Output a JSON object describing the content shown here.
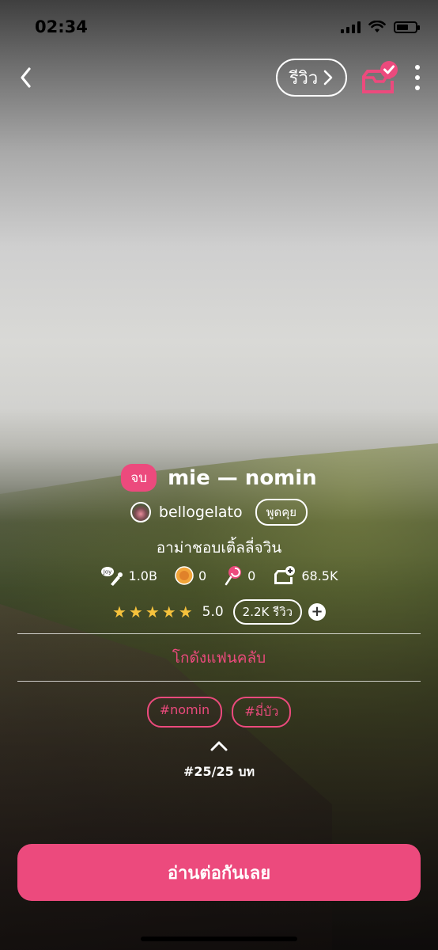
{
  "status_bar": {
    "time": "02:34"
  },
  "header": {
    "review_label": "รีวิว"
  },
  "story": {
    "end_badge": "จบ",
    "title": "mie — nomin",
    "author": "bellogelato",
    "chat_label": "พูดคุย",
    "description": "อาม่าชอบเติ้ลลี่จวิน"
  },
  "stats": {
    "views": "1.0B",
    "coins": "0",
    "candies": "0",
    "shelf_adds": "68.5K"
  },
  "rating": {
    "stars": 5,
    "value": "5.0",
    "review_count": "2.2K รีวิว"
  },
  "fanclub_label": "โกดังแฟนคลับ",
  "tags": [
    "#nomin",
    "#มี่บัว"
  ],
  "chapter_label": "#25/25 บท",
  "read_button": "อ่านต่อกันเลย",
  "colors": {
    "accent": "#ec4a7d",
    "star": "#f6c23c"
  }
}
